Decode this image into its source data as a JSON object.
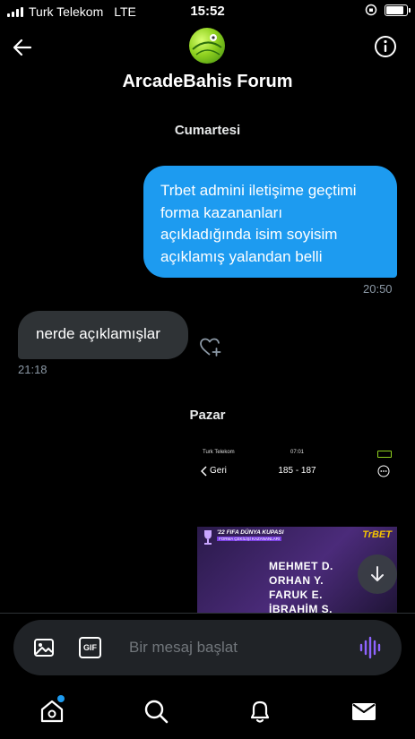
{
  "status_bar": {
    "carrier": "Turk Telekom",
    "network": "LTE",
    "time": "15:52",
    "battery_level": 0.95
  },
  "header": {
    "title": "ArcadeBahis Forum",
    "back_icon": "arrow-left-icon",
    "info_icon": "info-icon"
  },
  "conversation": {
    "day_1": "Cumartesi",
    "outgoing_message": "Trbet admini iletişime geçtimi\nforma kazananları\naçıkladığında isim soyisim\naçıklamış yalandan belli",
    "outgoing_time": "20:50",
    "incoming_message": "nerde açıklamışlar",
    "incoming_time": "21:18",
    "day_2": "Pazar"
  },
  "media_preview": {
    "status_carrier": "Turk Telekom",
    "status_time": "07:01",
    "back_label": "Geri",
    "page_range": "185 - 187",
    "promo_line1": "'22 FIFA DÜNYA KUPASI",
    "promo_line2": "FORMA ÇEKİLİŞİ KAZANANLARI",
    "brand": "TrBET",
    "names": [
      "MEHMET D.",
      "ORHAN Y.",
      "FARUK E.",
      "İBRAHİM S."
    ]
  },
  "composer": {
    "placeholder": "Bir mesaj başlat",
    "image_icon": "image-icon",
    "gif_label": "GIF",
    "voice_icon": "voice-wave-icon"
  },
  "tab_bar": {
    "items": [
      "home-icon",
      "search-icon",
      "notifications-icon",
      "messages-icon"
    ],
    "home_has_badge": true
  },
  "colors": {
    "accent": "#1d9bf0",
    "incoming_bubble": "#2f3336",
    "composer_bg": "#202327",
    "background": "#000000",
    "muted_text": "#8b98a5"
  }
}
